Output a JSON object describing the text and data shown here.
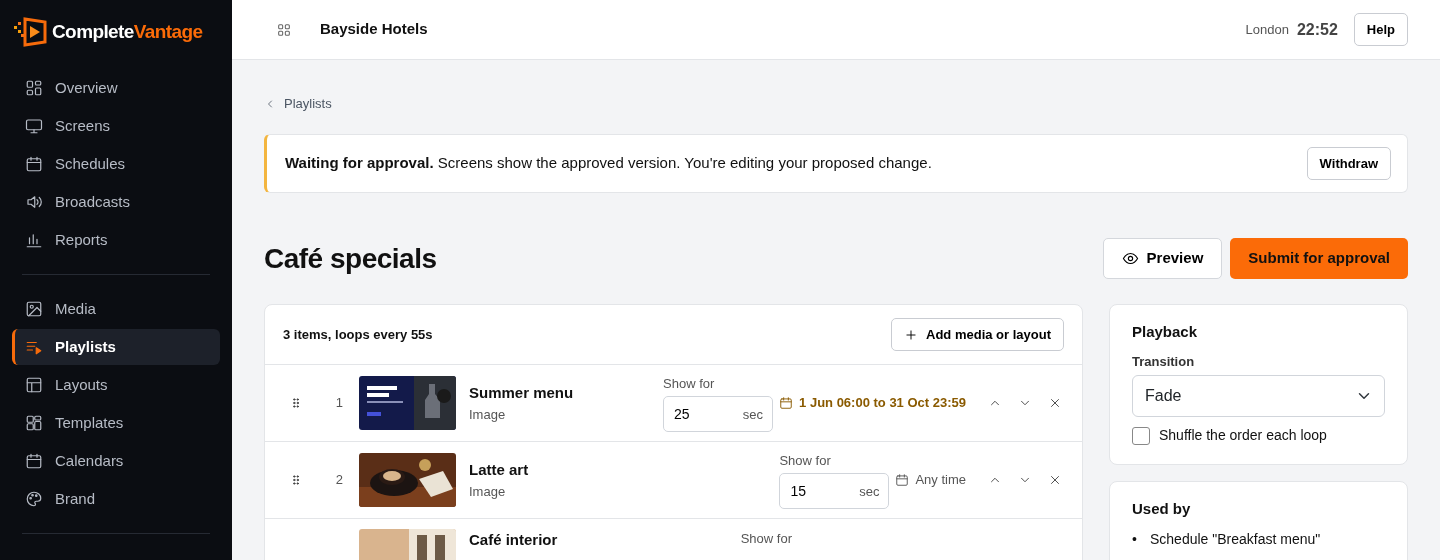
{
  "brand": {
    "first": "Complete",
    "second": "Vantage"
  },
  "sidebar": {
    "groups": [
      {
        "items": [
          {
            "label": "Overview",
            "selected": false
          },
          {
            "label": "Screens",
            "selected": false
          },
          {
            "label": "Schedules",
            "selected": false
          },
          {
            "label": "Broadcasts",
            "selected": false
          },
          {
            "label": "Reports",
            "selected": false
          }
        ]
      },
      {
        "items": [
          {
            "label": "Media",
            "selected": false
          },
          {
            "label": "Playlists",
            "selected": true
          },
          {
            "label": "Layouts",
            "selected": false
          },
          {
            "label": "Templates",
            "selected": false
          },
          {
            "label": "Calendars",
            "selected": false
          },
          {
            "label": "Brand",
            "selected": false
          }
        ]
      }
    ]
  },
  "header": {
    "organisation": "Bayside Hotels",
    "city": "London",
    "time": "22:52",
    "help": "Help"
  },
  "breadcrumb": "Playlists",
  "alert": {
    "text": "**Waiting for approval.** Screens show the approved version. You're editing your proposed change.",
    "button": "Withdraw"
  },
  "page": {
    "title": "Café specials",
    "preview": "Preview",
    "submit": "Submit for approval"
  },
  "playlist": {
    "summary": "3 items, loops every 55s",
    "add": "Add media or layout",
    "items": [
      {
        "number": "1",
        "name": "Summer menu",
        "type": "Image",
        "show_for_label": "Show for",
        "duration": "25",
        "unit": "sec",
        "schedule": {
          "kind": "range",
          "text": "1 Jun 06:00 to 31 Oct 23:59"
        }
      },
      {
        "number": "2",
        "name": "Latte art",
        "type": "Image",
        "show_for_label": "Show for",
        "duration": "15",
        "unit": "sec",
        "schedule": {
          "kind": "any",
          "text": "Any time"
        }
      },
      {
        "name": "Café interior",
        "show_for_label": "Show for"
      }
    ]
  },
  "playback": {
    "title": "Playback",
    "transition_label": "Transition",
    "transition": "Fade",
    "shuffle": {
      "label": "Shuffle the order each loop",
      "checked": false
    }
  },
  "used_by": {
    "title": "Used by",
    "bullet": "•",
    "items": [
      "Schedule \"Breakfast menu\""
    ]
  }
}
